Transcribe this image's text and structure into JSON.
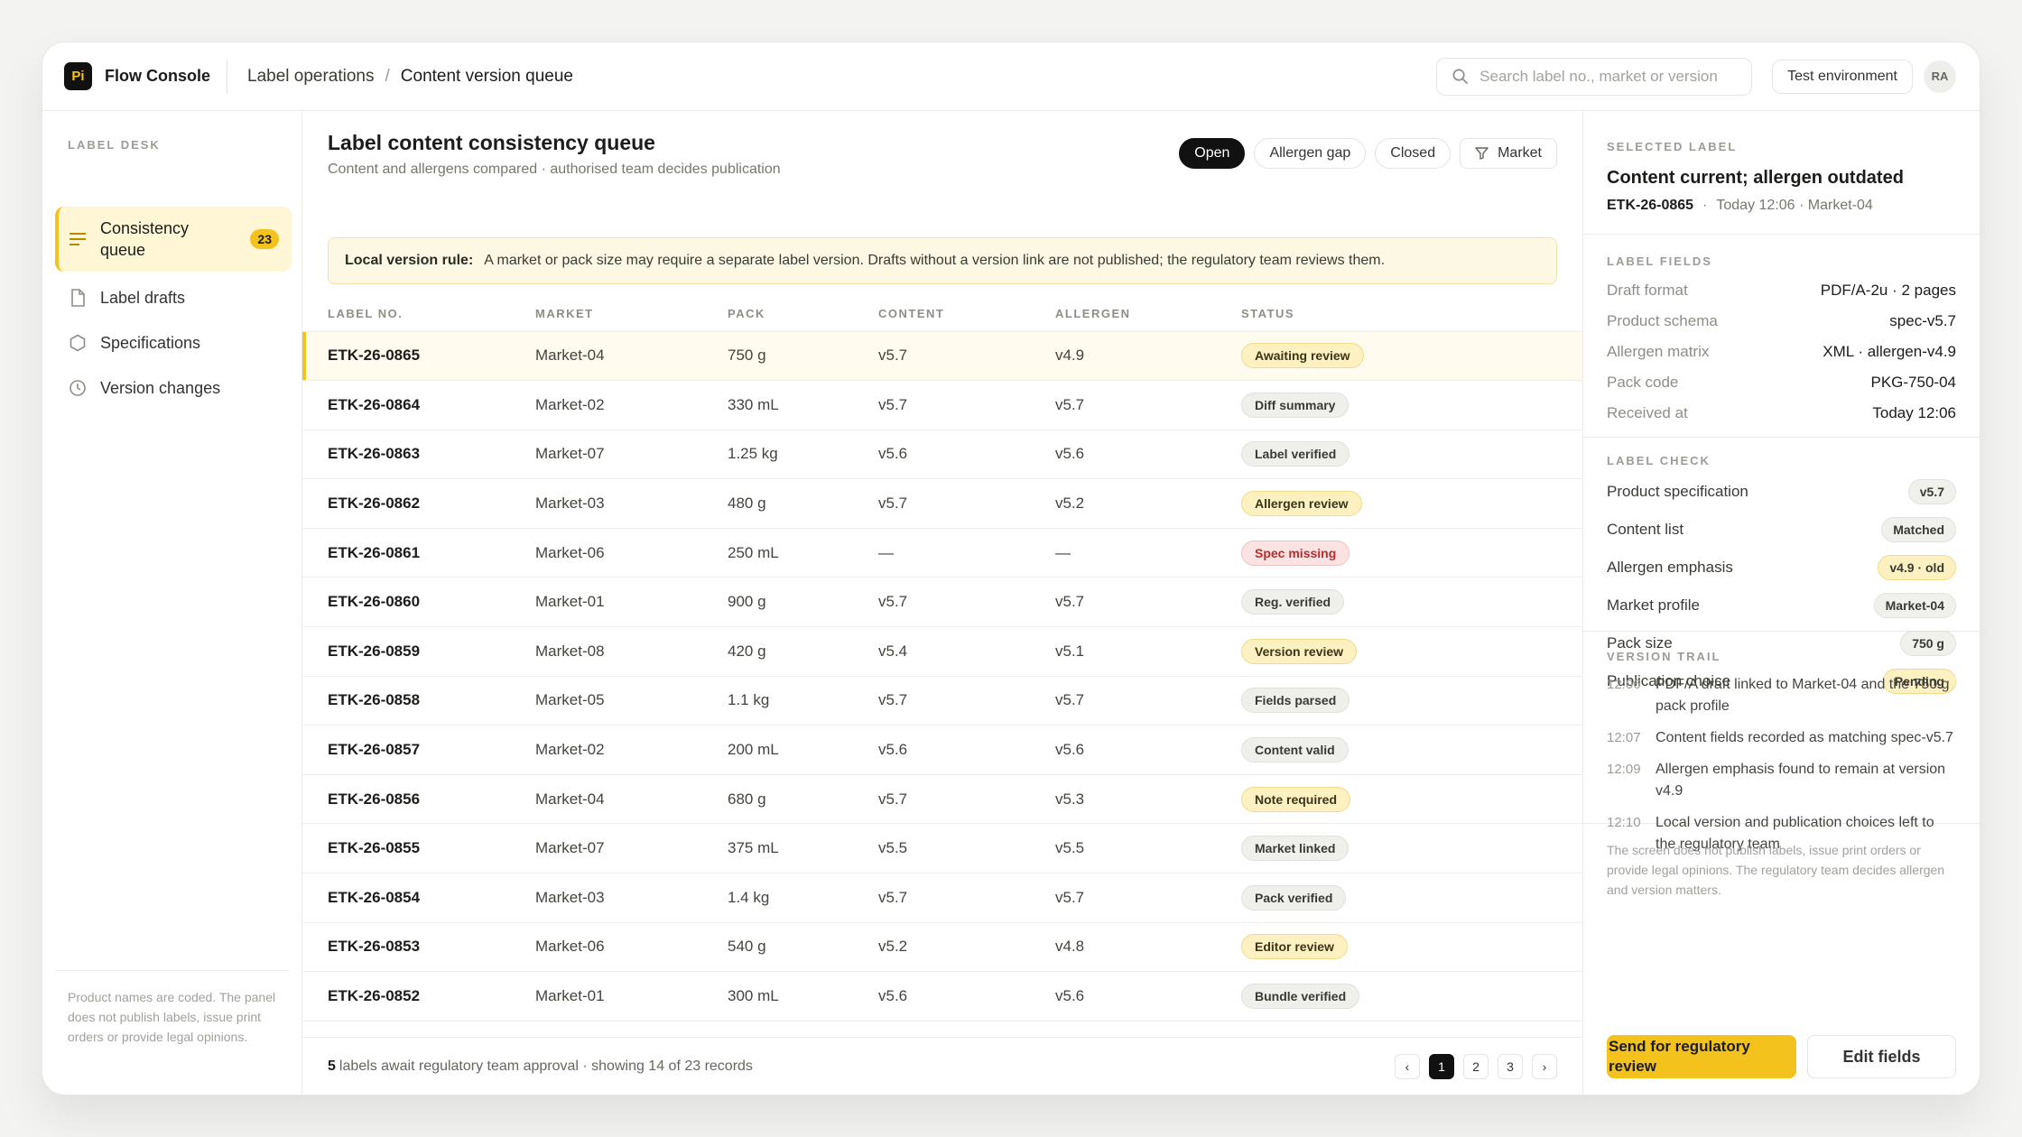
{
  "app": {
    "logo": "Pi",
    "name": "Flow Console"
  },
  "breadcrumb": {
    "parent": "Label operations",
    "separator": "/",
    "current": "Content version queue"
  },
  "search": {
    "placeholder": "Search label no., market or version"
  },
  "header": {
    "env_label": "Test environment",
    "avatar_initials": "RA"
  },
  "sidebar": {
    "title": "LABEL DESK",
    "items": [
      {
        "label": "Consistency queue",
        "badge": "23",
        "icon": "list-icon"
      },
      {
        "label": "Label drafts",
        "icon": "document-icon"
      },
      {
        "label": "Specifications",
        "icon": "hexagon-icon"
      },
      {
        "label": "Version changes",
        "icon": "clock-icon"
      }
    ],
    "footer": "Product names are coded. The panel does not publish labels, issue print orders or provide legal opinions."
  },
  "main": {
    "title": "Label content consistency queue",
    "subtitle": "Content and allergens compared · authorised team decides publication",
    "filters": [
      "Open",
      "Allergen gap",
      "Closed"
    ],
    "market_filter": "Market",
    "rule_label": "Local version rule:",
    "rule_text": "A market or pack size may require a separate label version. Drafts without a version link are not published; the regulatory team reviews them.",
    "columns": [
      "LABEL NO.",
      "MARKET",
      "PACK",
      "CONTENT",
      "ALLERGEN",
      "STATUS"
    ],
    "rows": [
      {
        "id": "ETK-26-0865",
        "market": "Market-04",
        "pack": "750 g",
        "content": "v5.7",
        "allergen": "v4.9",
        "status": "Awaiting review",
        "tone": "yellow"
      },
      {
        "id": "ETK-26-0864",
        "market": "Market-02",
        "pack": "330 mL",
        "content": "v5.7",
        "allergen": "v5.7",
        "status": "Diff summary",
        "tone": "grey"
      },
      {
        "id": "ETK-26-0863",
        "market": "Market-07",
        "pack": "1.25 kg",
        "content": "v5.6",
        "allergen": "v5.6",
        "status": "Label verified",
        "tone": "grey"
      },
      {
        "id": "ETK-26-0862",
        "market": "Market-03",
        "pack": "480 g",
        "content": "v5.7",
        "allergen": "v5.2",
        "status": "Allergen review",
        "tone": "yellow"
      },
      {
        "id": "ETK-26-0861",
        "market": "Market-06",
        "pack": "250 mL",
        "content": "—",
        "allergen": "—",
        "status": "Spec missing",
        "tone": "red"
      },
      {
        "id": "ETK-26-0860",
        "market": "Market-01",
        "pack": "900 g",
        "content": "v5.7",
        "allergen": "v5.7",
        "status": "Reg. verified",
        "tone": "grey"
      },
      {
        "id": "ETK-26-0859",
        "market": "Market-08",
        "pack": "420 g",
        "content": "v5.4",
        "allergen": "v5.1",
        "status": "Version review",
        "tone": "yellow"
      },
      {
        "id": "ETK-26-0858",
        "market": "Market-05",
        "pack": "1.1 kg",
        "content": "v5.7",
        "allergen": "v5.7",
        "status": "Fields parsed",
        "tone": "grey"
      },
      {
        "id": "ETK-26-0857",
        "market": "Market-02",
        "pack": "200 mL",
        "content": "v5.6",
        "allergen": "v5.6",
        "status": "Content valid",
        "tone": "grey"
      },
      {
        "id": "ETK-26-0856",
        "market": "Market-04",
        "pack": "680 g",
        "content": "v5.7",
        "allergen": "v5.3",
        "status": "Note required",
        "tone": "yellow"
      },
      {
        "id": "ETK-26-0855",
        "market": "Market-07",
        "pack": "375 mL",
        "content": "v5.5",
        "allergen": "v5.5",
        "status": "Market linked",
        "tone": "grey"
      },
      {
        "id": "ETK-26-0854",
        "market": "Market-03",
        "pack": "1.4 kg",
        "content": "v5.7",
        "allergen": "v5.7",
        "status": "Pack verified",
        "tone": "grey"
      },
      {
        "id": "ETK-26-0853",
        "market": "Market-06",
        "pack": "540 g",
        "content": "v5.2",
        "allergen": "v4.8",
        "status": "Editor review",
        "tone": "yellow"
      },
      {
        "id": "ETK-26-0852",
        "market": "Market-01",
        "pack": "300 mL",
        "content": "v5.6",
        "allergen": "v5.6",
        "status": "Bundle verified",
        "tone": "grey"
      }
    ],
    "footer_count": "5",
    "footer_text": "labels await regulatory team approval · showing 14 of 23 records",
    "pages": [
      "1",
      "2",
      "3"
    ],
    "prev": "‹",
    "next": "›"
  },
  "panel": {
    "selected_title": "SELECTED LABEL",
    "headline": "Content current; allergen outdated",
    "label_id": "ETK-26-0865",
    "meta_dot": "·",
    "meta": "Today 12:06 · Market-04",
    "fields_title": "LABEL FIELDS",
    "fields": [
      {
        "k": "Draft format",
        "v": "PDF/A-2u · 2 pages"
      },
      {
        "k": "Product schema",
        "v": "spec-v5.7"
      },
      {
        "k": "Allergen matrix",
        "v": "XML · allergen-v4.9"
      },
      {
        "k": "Pack code",
        "v": "PKG-750-04"
      },
      {
        "k": "Received at",
        "v": "Today 12:06"
      }
    ],
    "check_title": "LABEL CHECK",
    "checks": [
      {
        "k": "Product specification",
        "v": "v5.7",
        "tone": "grey"
      },
      {
        "k": "Content list",
        "v": "Matched",
        "tone": "grey"
      },
      {
        "k": "Allergen emphasis",
        "v": "v4.9 · old",
        "tone": "yellow"
      },
      {
        "k": "Market profile",
        "v": "Market-04",
        "tone": "grey"
      },
      {
        "k": "Pack size",
        "v": "750 g",
        "tone": "grey"
      },
      {
        "k": "Publication choice",
        "v": "Pending",
        "tone": "yellow"
      }
    ],
    "trail_title": "VERSION TRAIL",
    "trail": [
      {
        "t": "12:06",
        "text": "PDF/A draft linked to Market-04 and the 750 g pack profile"
      },
      {
        "t": "12:07",
        "text": "Content fields recorded as matching spec-v5.7"
      },
      {
        "t": "12:09",
        "text": "Allergen emphasis found to remain at version v4.9"
      },
      {
        "t": "12:10",
        "text": "Local version and publication choices left to the regulatory team"
      }
    ],
    "disclaimer": "The screen does not publish labels, issue print orders or provide legal opinions. The regulatory team decides allergen and version matters.",
    "primary_button": "Send for regulatory review",
    "secondary_button": "Edit fields"
  },
  "colors": {
    "accent": "#f3c21c",
    "selected_row": "#fffbee",
    "rule_bg": "#fdf8e4",
    "danger": "#b42c2c"
  }
}
